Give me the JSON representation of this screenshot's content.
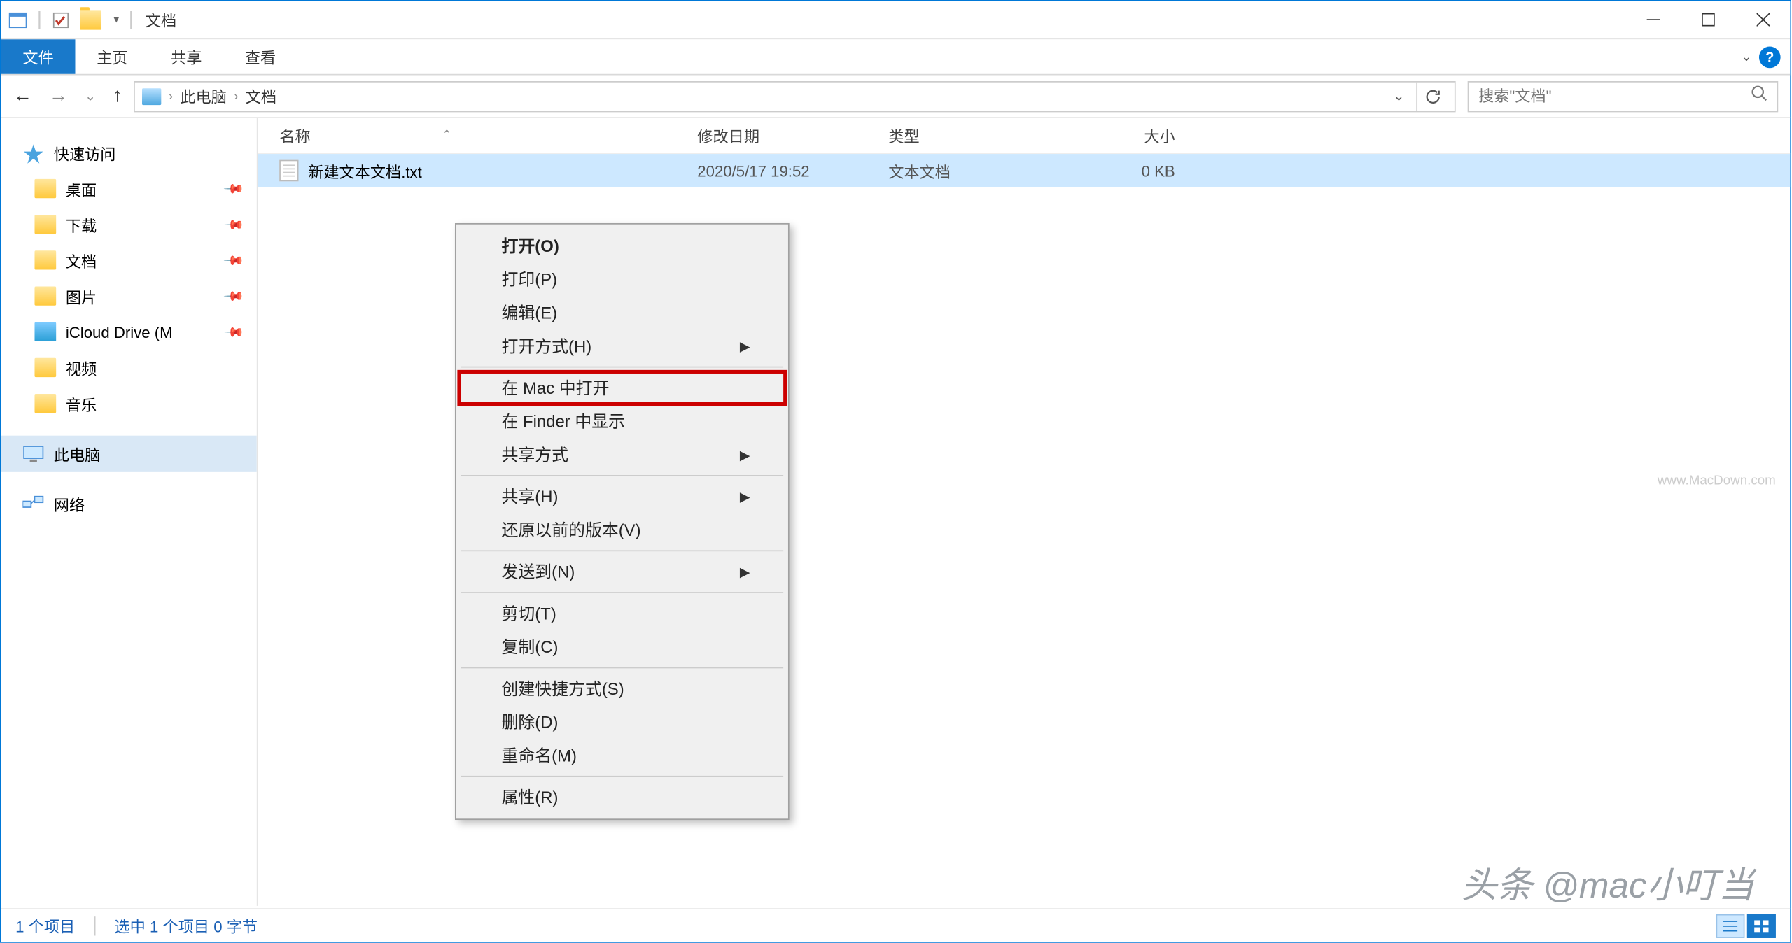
{
  "titlebar": {
    "title": "文档"
  },
  "ribbon": {
    "file": "文件",
    "home": "主页",
    "share": "共享",
    "view": "查看"
  },
  "breadcrumb": {
    "pc": "此电脑",
    "docs": "文档"
  },
  "search": {
    "placeholder": "搜索\"文档\""
  },
  "sidebar": {
    "quick": "快速访问",
    "desktop": "桌面",
    "downloads": "下载",
    "documents": "文档",
    "pictures": "图片",
    "icloud": "iCloud Drive (M",
    "video": "视频",
    "music": "音乐",
    "thispc": "此电脑",
    "network": "网络"
  },
  "columns": {
    "name": "名称",
    "date": "修改日期",
    "type": "类型",
    "size": "大小"
  },
  "file": {
    "name": "新建文本文档.txt",
    "date": "2020/5/17 19:52",
    "type": "文本文档",
    "size": "0 KB"
  },
  "menu": {
    "open": "打开(O)",
    "print": "打印(P)",
    "edit": "编辑(E)",
    "openwith": "打开方式(H)",
    "openmac": "在 Mac 中打开",
    "showfinder": "在 Finder 中显示",
    "sharemode": "共享方式",
    "share": "共享(H)",
    "restore": "还原以前的版本(V)",
    "sendto": "发送到(N)",
    "cut": "剪切(T)",
    "copy": "复制(C)",
    "shortcut": "创建快捷方式(S)",
    "delete": "删除(D)",
    "rename": "重命名(M)",
    "props": "属性(R)"
  },
  "status": {
    "items": "1 个项目",
    "selected": "选中 1 个项目 0 字节"
  },
  "watermark1": "www.MacDown.com",
  "watermark2": "头条 @mac小叮当"
}
